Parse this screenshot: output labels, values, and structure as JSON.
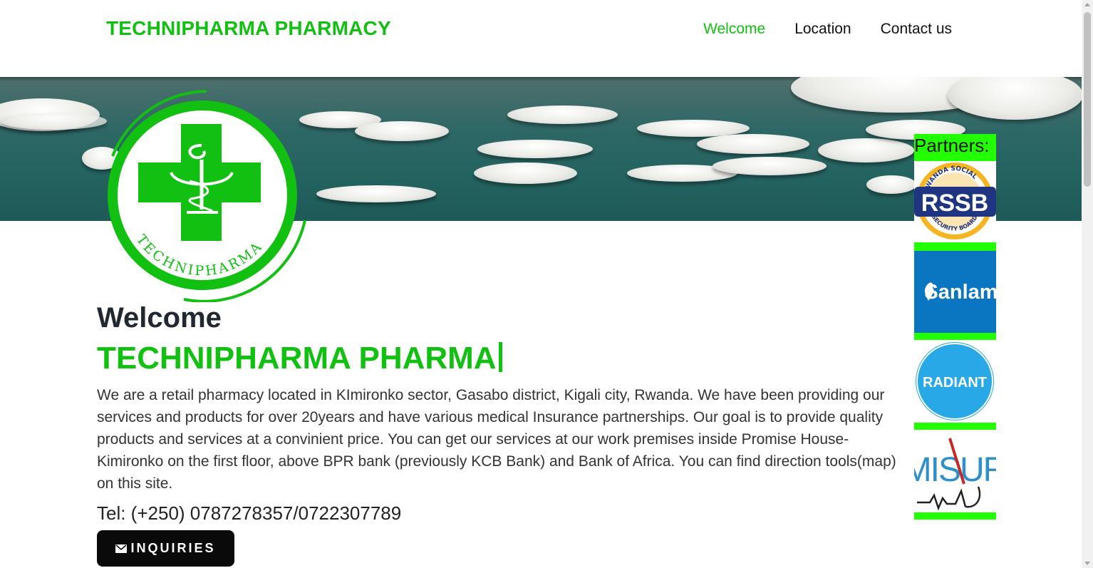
{
  "header": {
    "brand": "TECHNIPHARMA PHARMACY",
    "nav": [
      "Welcome",
      "Location",
      "Contact us"
    ],
    "active_nav": "Welcome"
  },
  "logo": {
    "text": "TECHNIPHARMA"
  },
  "main": {
    "welcome": "Welcome",
    "typed_text": "TECHNIPHARMA PHARMA",
    "description": "We are a retail pharmacy located in KImironko sector, Gasabo district, Kigali city, Rwanda. We have been providing our services and products for over 20years and have various medical Insurance partnerships. Our goal is to provide quality products and services at a convinient price. You can get our services at our work premises inside Promise House-Kimironko on the first floor, above BPR bank (previously KCB Bank) and Bank of Africa. You can find direction tools(map) on this site.",
    "tel": "Tel: (+250) 0787278357/0722307789",
    "inquiries_label": "INQUIRIES"
  },
  "partners": {
    "title": "Partners:",
    "items": [
      {
        "name": "RSSB",
        "top_text": "RWANDA SOCIAL",
        "bottom_text": "SECURITY BOARD"
      },
      {
        "name": "Sanlam"
      },
      {
        "name": "RADIANT"
      },
      {
        "name": "MISUR"
      }
    ]
  },
  "colors": {
    "brand_green": "#11c011",
    "partner_green": "#22ff00",
    "button_bg": "#0a0a0a"
  }
}
